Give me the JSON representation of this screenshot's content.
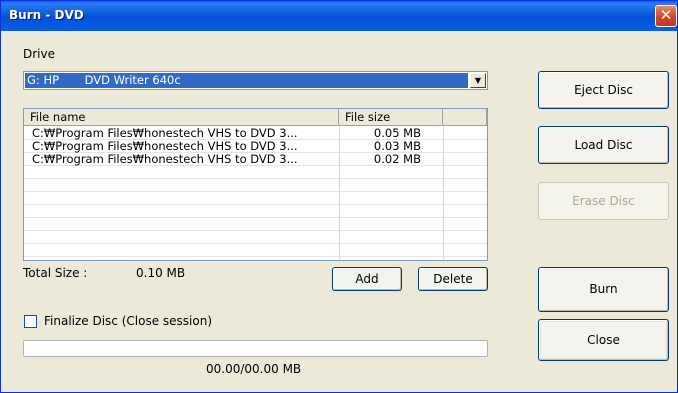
{
  "window": {
    "title": "Burn - DVD",
    "close_glyph": "✕"
  },
  "drive": {
    "label": "Drive",
    "selected": "G: HP       DVD Writer 640c",
    "arrow_glyph": "▼"
  },
  "file_list": {
    "columns": [
      "File name",
      "File size"
    ],
    "rows": [
      {
        "name": "C:₩Program Files₩honestech VHS to DVD 3...",
        "size": "0.05 MB"
      },
      {
        "name": "C:₩Program Files₩honestech VHS to DVD 3...",
        "size": "0.03 MB"
      },
      {
        "name": "C:₩Program Files₩honestech VHS to DVD 3...",
        "size": "0.02 MB"
      }
    ]
  },
  "total": {
    "label": "Total Size :",
    "value": "0.10 MB"
  },
  "list_buttons": {
    "add": "Add",
    "delete": "Delete"
  },
  "finalize": {
    "label": "Finalize Disc  (Close session)",
    "checked": false
  },
  "progress": {
    "text": "00.00/00.00 MB",
    "fraction": 0
  },
  "side_buttons": {
    "eject": "Eject Disc",
    "load": "Load Disc",
    "erase": "Erase Disc",
    "burn": "Burn",
    "close": "Close"
  }
}
